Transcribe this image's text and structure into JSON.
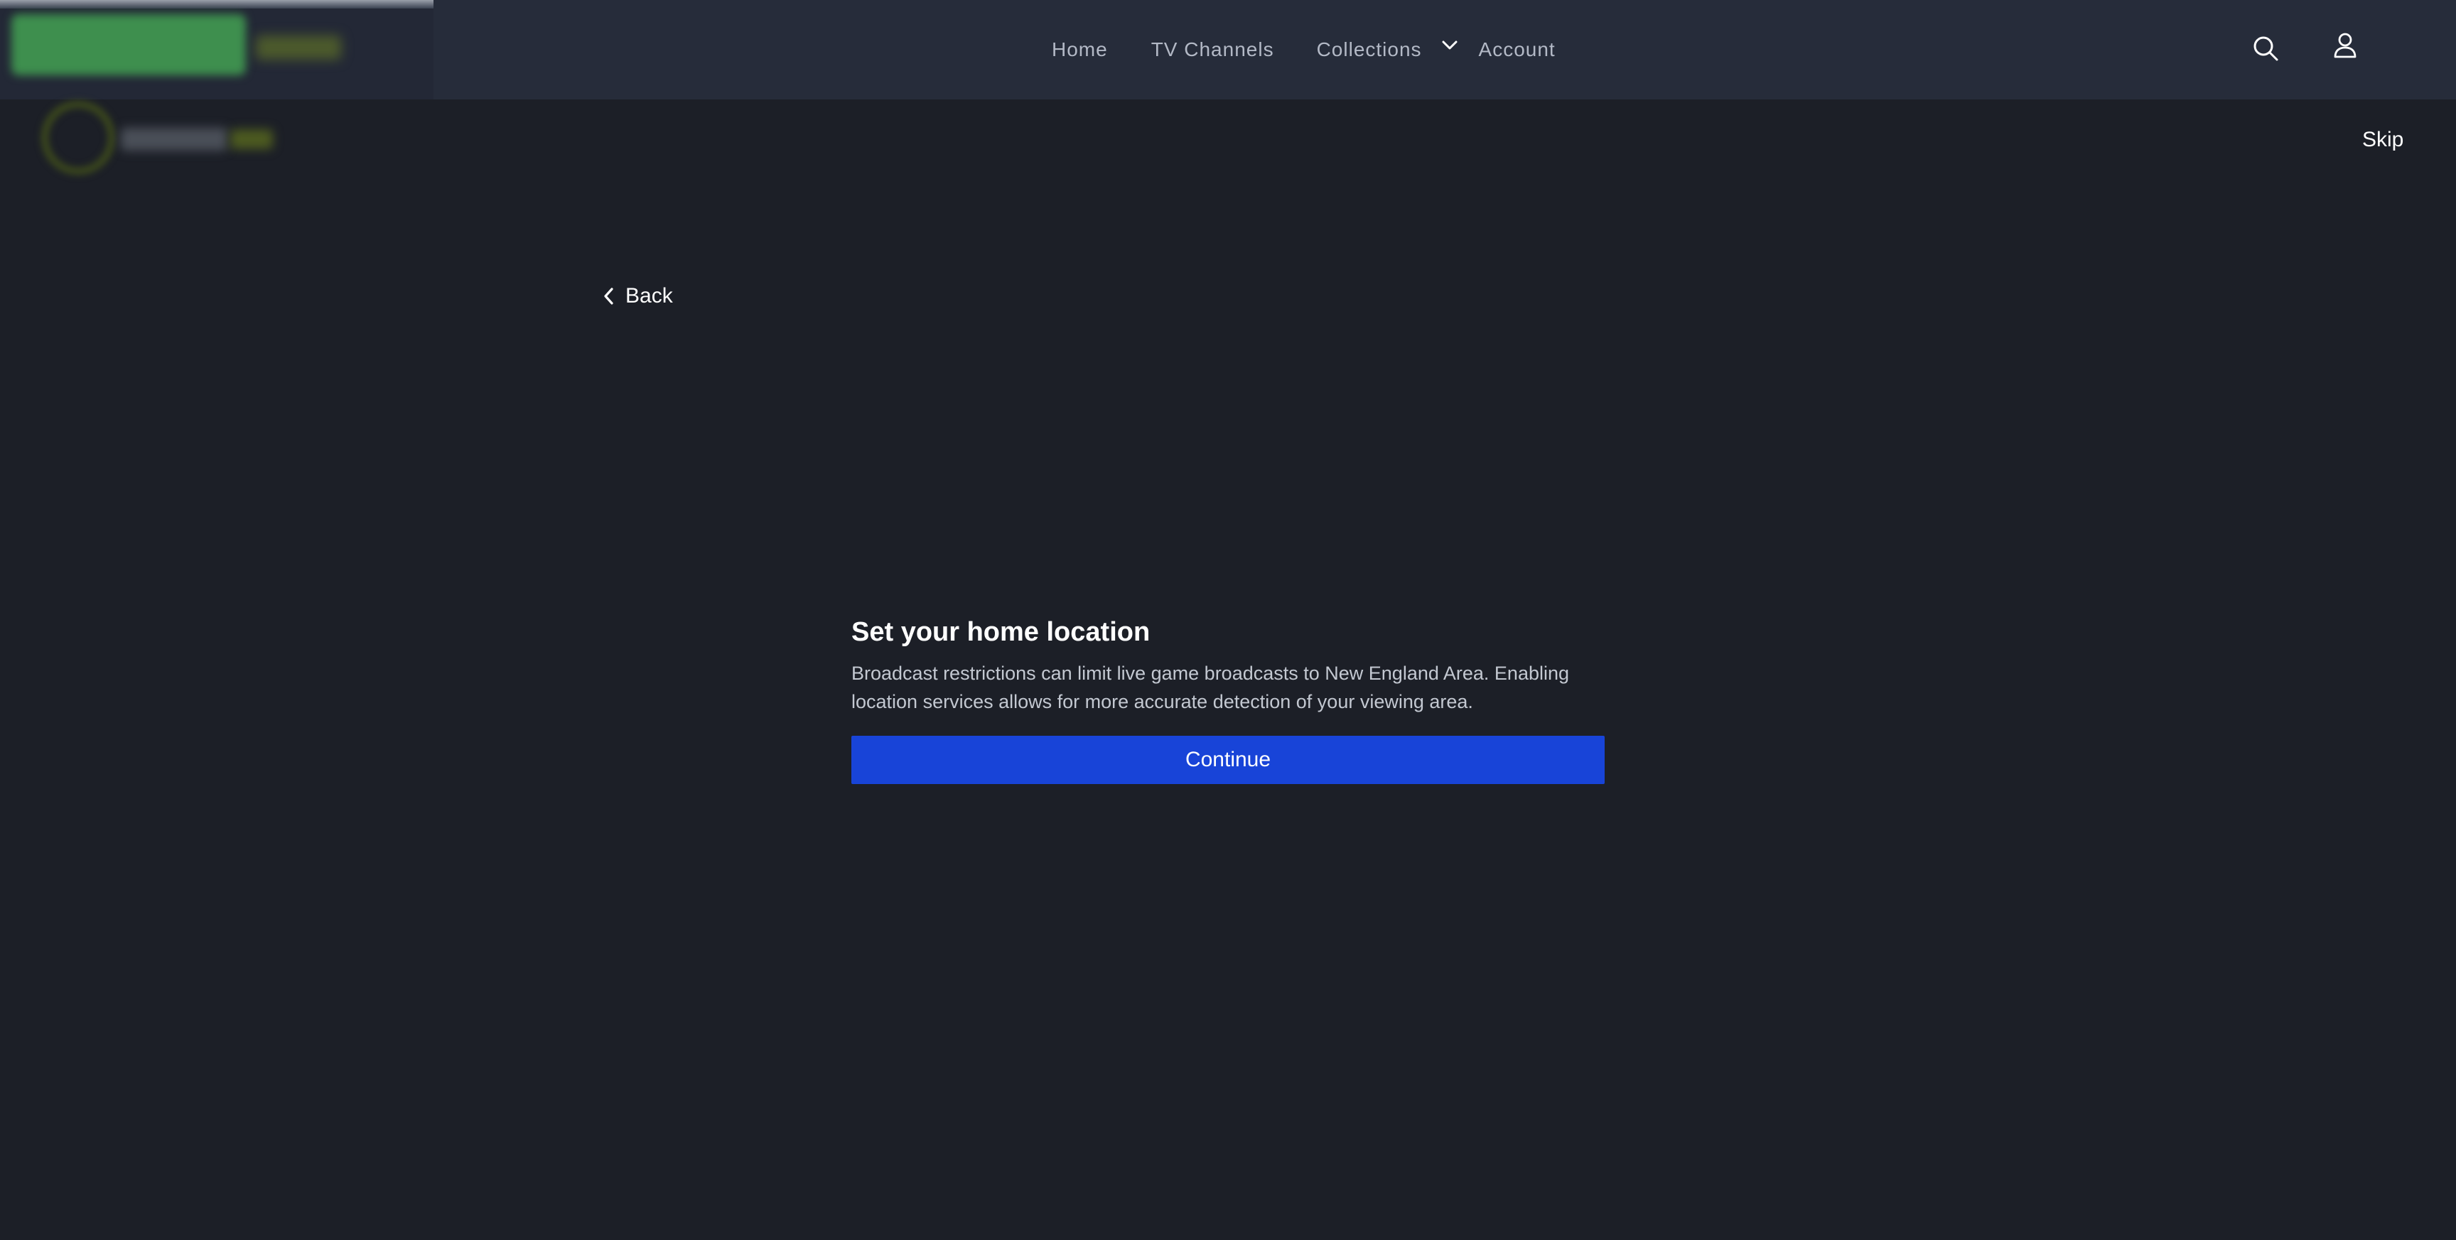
{
  "nav": {
    "items": [
      {
        "label": "Home"
      },
      {
        "label": "TV Channels"
      },
      {
        "label": "Collections"
      },
      {
        "label": "Account"
      }
    ]
  },
  "header": {
    "search_icon": "search-icon",
    "account_icon": "user-icon"
  },
  "page": {
    "skip_label": "Skip",
    "back_label": "Back"
  },
  "location_prompt": {
    "title": "Set your home location",
    "description": "Broadcast restrictions can limit live game broadcasts to New England Area. Enabling location services allows for more accurate detection of your viewing area.",
    "continue_label": "Continue"
  },
  "colors": {
    "background": "#1c1f27",
    "header": "#262c3a",
    "primary_button": "#1844d8"
  }
}
